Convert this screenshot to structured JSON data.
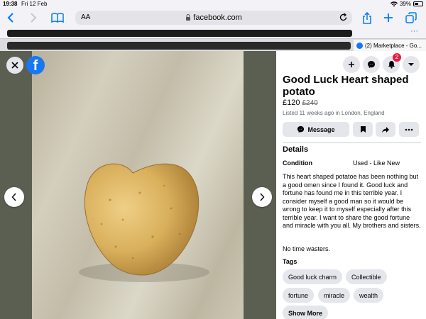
{
  "status": {
    "time": "19:38",
    "date": "Fri 12 Feb",
    "battery": "39%"
  },
  "browser": {
    "text_size": "AA",
    "url": "facebook.com",
    "active_tab": "(2) Marketplace - Go..."
  },
  "viewer": {
    "logo": "f"
  },
  "listing": {
    "title": "Good Luck Heart shaped potato",
    "price": "£120",
    "old_price": "£240",
    "listed": "Listed 11 weeks ago in London, England",
    "notification_count": "2",
    "message_label": "Message",
    "details_heading": "Details",
    "condition_label": "Condition",
    "condition_value": "Used - Like New",
    "description": "This heart shaped potatoe has been nothing but a good omen since I found it. Good luck and fortune has found me in this terrible year. I consider myself a good man so it would be wrong to keep it to myself especially after this terrible year. I want to share the good fortune and miracle with you all. My brothers and sisters.",
    "footer_note": "No time wasters.",
    "tags_heading": "Tags",
    "tags": [
      "Good luck charm",
      "Collectible",
      "fortune",
      "miracle",
      "wealth"
    ],
    "show_more": "Show More"
  },
  "colors": {
    "facebook_blue": "#1877f2",
    "badge_red": "#e41e3f",
    "ios_blue": "#007aff"
  }
}
